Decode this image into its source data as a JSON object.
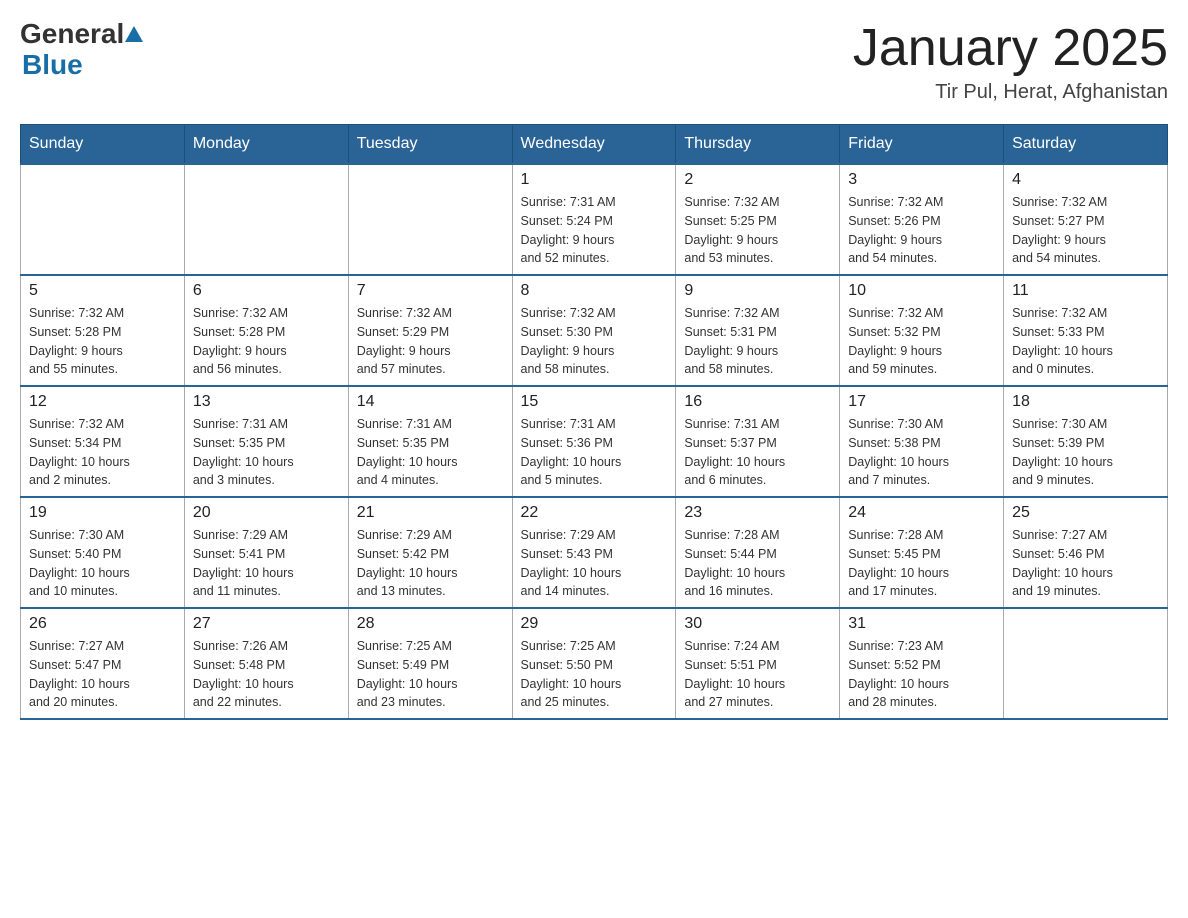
{
  "header": {
    "logo_general": "General",
    "logo_blue": "Blue",
    "month_title": "January 2025",
    "location": "Tir Pul, Herat, Afghanistan"
  },
  "weekdays": [
    "Sunday",
    "Monday",
    "Tuesday",
    "Wednesday",
    "Thursday",
    "Friday",
    "Saturday"
  ],
  "weeks": [
    [
      {
        "day": "",
        "info": ""
      },
      {
        "day": "",
        "info": ""
      },
      {
        "day": "",
        "info": ""
      },
      {
        "day": "1",
        "info": "Sunrise: 7:31 AM\nSunset: 5:24 PM\nDaylight: 9 hours\nand 52 minutes."
      },
      {
        "day": "2",
        "info": "Sunrise: 7:32 AM\nSunset: 5:25 PM\nDaylight: 9 hours\nand 53 minutes."
      },
      {
        "day": "3",
        "info": "Sunrise: 7:32 AM\nSunset: 5:26 PM\nDaylight: 9 hours\nand 54 minutes."
      },
      {
        "day": "4",
        "info": "Sunrise: 7:32 AM\nSunset: 5:27 PM\nDaylight: 9 hours\nand 54 minutes."
      }
    ],
    [
      {
        "day": "5",
        "info": "Sunrise: 7:32 AM\nSunset: 5:28 PM\nDaylight: 9 hours\nand 55 minutes."
      },
      {
        "day": "6",
        "info": "Sunrise: 7:32 AM\nSunset: 5:28 PM\nDaylight: 9 hours\nand 56 minutes."
      },
      {
        "day": "7",
        "info": "Sunrise: 7:32 AM\nSunset: 5:29 PM\nDaylight: 9 hours\nand 57 minutes."
      },
      {
        "day": "8",
        "info": "Sunrise: 7:32 AM\nSunset: 5:30 PM\nDaylight: 9 hours\nand 58 minutes."
      },
      {
        "day": "9",
        "info": "Sunrise: 7:32 AM\nSunset: 5:31 PM\nDaylight: 9 hours\nand 58 minutes."
      },
      {
        "day": "10",
        "info": "Sunrise: 7:32 AM\nSunset: 5:32 PM\nDaylight: 9 hours\nand 59 minutes."
      },
      {
        "day": "11",
        "info": "Sunrise: 7:32 AM\nSunset: 5:33 PM\nDaylight: 10 hours\nand 0 minutes."
      }
    ],
    [
      {
        "day": "12",
        "info": "Sunrise: 7:32 AM\nSunset: 5:34 PM\nDaylight: 10 hours\nand 2 minutes."
      },
      {
        "day": "13",
        "info": "Sunrise: 7:31 AM\nSunset: 5:35 PM\nDaylight: 10 hours\nand 3 minutes."
      },
      {
        "day": "14",
        "info": "Sunrise: 7:31 AM\nSunset: 5:35 PM\nDaylight: 10 hours\nand 4 minutes."
      },
      {
        "day": "15",
        "info": "Sunrise: 7:31 AM\nSunset: 5:36 PM\nDaylight: 10 hours\nand 5 minutes."
      },
      {
        "day": "16",
        "info": "Sunrise: 7:31 AM\nSunset: 5:37 PM\nDaylight: 10 hours\nand 6 minutes."
      },
      {
        "day": "17",
        "info": "Sunrise: 7:30 AM\nSunset: 5:38 PM\nDaylight: 10 hours\nand 7 minutes."
      },
      {
        "day": "18",
        "info": "Sunrise: 7:30 AM\nSunset: 5:39 PM\nDaylight: 10 hours\nand 9 minutes."
      }
    ],
    [
      {
        "day": "19",
        "info": "Sunrise: 7:30 AM\nSunset: 5:40 PM\nDaylight: 10 hours\nand 10 minutes."
      },
      {
        "day": "20",
        "info": "Sunrise: 7:29 AM\nSunset: 5:41 PM\nDaylight: 10 hours\nand 11 minutes."
      },
      {
        "day": "21",
        "info": "Sunrise: 7:29 AM\nSunset: 5:42 PM\nDaylight: 10 hours\nand 13 minutes."
      },
      {
        "day": "22",
        "info": "Sunrise: 7:29 AM\nSunset: 5:43 PM\nDaylight: 10 hours\nand 14 minutes."
      },
      {
        "day": "23",
        "info": "Sunrise: 7:28 AM\nSunset: 5:44 PM\nDaylight: 10 hours\nand 16 minutes."
      },
      {
        "day": "24",
        "info": "Sunrise: 7:28 AM\nSunset: 5:45 PM\nDaylight: 10 hours\nand 17 minutes."
      },
      {
        "day": "25",
        "info": "Sunrise: 7:27 AM\nSunset: 5:46 PM\nDaylight: 10 hours\nand 19 minutes."
      }
    ],
    [
      {
        "day": "26",
        "info": "Sunrise: 7:27 AM\nSunset: 5:47 PM\nDaylight: 10 hours\nand 20 minutes."
      },
      {
        "day": "27",
        "info": "Sunrise: 7:26 AM\nSunset: 5:48 PM\nDaylight: 10 hours\nand 22 minutes."
      },
      {
        "day": "28",
        "info": "Sunrise: 7:25 AM\nSunset: 5:49 PM\nDaylight: 10 hours\nand 23 minutes."
      },
      {
        "day": "29",
        "info": "Sunrise: 7:25 AM\nSunset: 5:50 PM\nDaylight: 10 hours\nand 25 minutes."
      },
      {
        "day": "30",
        "info": "Sunrise: 7:24 AM\nSunset: 5:51 PM\nDaylight: 10 hours\nand 27 minutes."
      },
      {
        "day": "31",
        "info": "Sunrise: 7:23 AM\nSunset: 5:52 PM\nDaylight: 10 hours\nand 28 minutes."
      },
      {
        "day": "",
        "info": ""
      }
    ]
  ]
}
